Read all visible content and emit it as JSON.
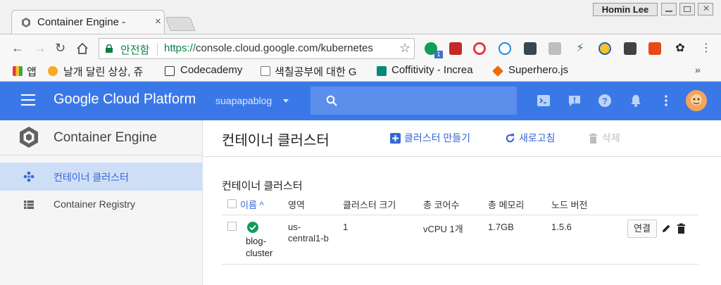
{
  "browser": {
    "tab_title": "Container Engine -",
    "tab_close": "×",
    "profile_name": "Homin Lee",
    "secure_label": "안전함",
    "url_protocol": "https://",
    "url_rest": "console.cloud.google.com/kubernetes",
    "extension_badge": "1",
    "bookmarks": [
      {
        "label": "앱"
      },
      {
        "label": "날개 달린 상상, 쥬"
      },
      {
        "label": "Codecademy"
      },
      {
        "label": "색칠공부에 대한 G"
      },
      {
        "label": "Coffitivity - Increa"
      },
      {
        "label": "Superhero.js"
      }
    ],
    "bookmarks_more": "»"
  },
  "header": {
    "title": "Google Cloud Platform",
    "project": "suapapablog",
    "search_placeholder": ""
  },
  "sidebar": {
    "product": "Container Engine",
    "items": [
      {
        "label": "컨테이너 클러스터",
        "icon": "cluster-icon",
        "active": true
      },
      {
        "label": "Container Registry",
        "icon": "registry-icon",
        "active": false
      }
    ]
  },
  "main": {
    "page_title": "컨테이너 클러스터",
    "actions": {
      "create": "클러스터 만들기",
      "refresh": "새로고침",
      "delete": "삭제"
    },
    "section_title": "컨테이너 클러스터",
    "table": {
      "columns": [
        "이름 ^",
        "영역",
        "클러스터 크기",
        "총 코어수",
        "총 메모리",
        "노드 버전"
      ],
      "rows": [
        {
          "name": "blog-cluster",
          "zone": "us-central1-b",
          "size": "1",
          "cores": "vCPU 1개",
          "memory": "1.7GB",
          "node_version": "1.5.6",
          "connect": "연결",
          "status": "running"
        }
      ]
    }
  },
  "colors": {
    "header_blue": "#3b78e7",
    "link_blue": "#3367d6",
    "ok_green": "#0f9d58",
    "active_item_bg": "#cfdef7"
  }
}
